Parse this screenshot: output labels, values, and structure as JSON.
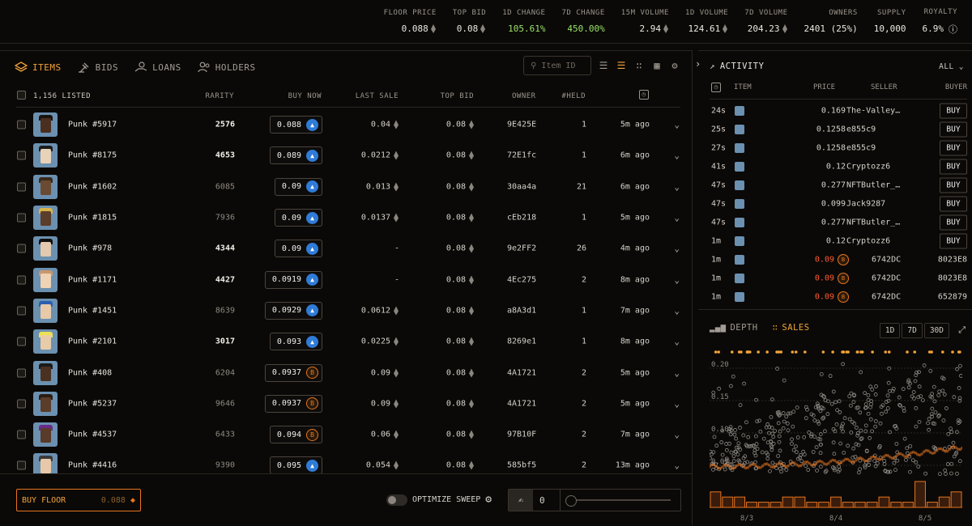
{
  "stats": [
    {
      "label": "FLOOR PRICE",
      "value": "0.088",
      "eth": true,
      "green": false
    },
    {
      "label": "TOP BID",
      "value": "0.08",
      "eth": true,
      "green": false
    },
    {
      "label": "1D CHANGE",
      "value": "105.61%",
      "eth": false,
      "green": true
    },
    {
      "label": "7D CHANGE",
      "value": "450.00%",
      "eth": false,
      "green": true
    },
    {
      "label": "15M VOLUME",
      "value": "2.94",
      "eth": true,
      "green": false
    },
    {
      "label": "1D VOLUME",
      "value": "124.61",
      "eth": true,
      "green": false
    },
    {
      "label": "7D VOLUME",
      "value": "204.23",
      "eth": true,
      "green": false
    },
    {
      "label": "OWNERS",
      "value": "2401 (25%)",
      "eth": false,
      "green": false
    },
    {
      "label": "SUPPLY",
      "value": "10,000",
      "eth": false,
      "green": false
    },
    {
      "label": "ROYALTY",
      "value": "6.9%",
      "eth": false,
      "green": false
    }
  ],
  "tabs": {
    "items": "ITEMS",
    "bids": "BIDS",
    "loans": "LOANS",
    "holders": "HOLDERS"
  },
  "search": {
    "placeholder": "Item ID"
  },
  "table": {
    "listed": "1,156 LISTED",
    "headers": {
      "rarity": "RARITY",
      "buy_now": "BUY NOW",
      "last_sale": "LAST SALE",
      "top_bid": "TOP BID",
      "owner": "OWNER",
      "held": "#HELD"
    },
    "rows": [
      {
        "name": "Punk #5917",
        "rarity": "2576",
        "rw": "b",
        "buy": "0.088",
        "mk": "b",
        "last": "0.04",
        "bid": "0.08",
        "owner": "9E425E",
        "held": "1",
        "age": "5m ago",
        "skin": "#4a2e1f",
        "hair": "#1a1410"
      },
      {
        "name": "Punk #8175",
        "rarity": "4653",
        "rw": "b",
        "buy": "0.089",
        "mk": "b",
        "last": "0.0212",
        "bid": "0.08",
        "owner": "72E1fc",
        "held": "1",
        "age": "6m ago",
        "skin": "#e8d2b8",
        "hair": "#1b1b1b"
      },
      {
        "name": "Punk #1602",
        "rarity": "6085",
        "rw": "d",
        "buy": "0.09",
        "mk": "b",
        "last": "0.013",
        "bid": "0.08",
        "owner": "30aa4a",
        "held": "21",
        "age": "6m ago",
        "skin": "#6a4a32",
        "hair": "#3a2a1d"
      },
      {
        "name": "Punk #1815",
        "rarity": "7936",
        "rw": "d",
        "buy": "0.09",
        "mk": "b",
        "last": "0.0137",
        "bid": "0.08",
        "owner": "cEb218",
        "held": "1",
        "age": "5m ago",
        "skin": "#5a3e2a",
        "hair": "#d8b24a"
      },
      {
        "name": "Punk #978",
        "rarity": "4344",
        "rw": "b",
        "buy": "0.09",
        "mk": "b",
        "last": "-",
        "bid": "0.08",
        "owner": "9e2FF2",
        "held": "26",
        "age": "4m ago",
        "skin": "#e3c9ad",
        "hair": "#101010"
      },
      {
        "name": "Punk #1171",
        "rarity": "4427",
        "rw": "b",
        "buy": "0.0919",
        "mk": "b",
        "last": "-",
        "bid": "0.08",
        "owner": "4Ec275",
        "held": "2",
        "age": "8m ago",
        "skin": "#f0d2b4",
        "hair": "#c89870"
      },
      {
        "name": "Punk #1451",
        "rarity": "8639",
        "rw": "d",
        "buy": "0.0929",
        "mk": "b",
        "last": "0.0612",
        "bid": "0.08",
        "owner": "a8A3d1",
        "held": "1",
        "age": "7m ago",
        "skin": "#e8c9a8",
        "hair": "#2a5fb0"
      },
      {
        "name": "Punk #2101",
        "rarity": "3017",
        "rw": "b",
        "buy": "0.093",
        "mk": "b",
        "last": "0.0225",
        "bid": "0.08",
        "owner": "8269e1",
        "held": "1",
        "age": "8m ago",
        "skin": "#e8ccaa",
        "hair": "#f0e050"
      },
      {
        "name": "Punk #408",
        "rarity": "6204",
        "rw": "d",
        "buy": "0.0937",
        "mk": "o",
        "last": "0.09",
        "bid": "0.08",
        "owner": "4A1721",
        "held": "2",
        "age": "5m ago",
        "skin": "#4a3020",
        "hair": "#1a1a1a"
      },
      {
        "name": "Punk #5237",
        "rarity": "9646",
        "rw": "d",
        "buy": "0.0937",
        "mk": "o",
        "last": "0.09",
        "bid": "0.08",
        "owner": "4A1721",
        "held": "2",
        "age": "5m ago",
        "skin": "#5a3c28",
        "hair": "#2a1c12"
      },
      {
        "name": "Punk #4537",
        "rarity": "6433",
        "rw": "d",
        "buy": "0.094",
        "mk": "o",
        "last": "0.06",
        "bid": "0.08",
        "owner": "97B10F",
        "held": "2",
        "age": "7m ago",
        "skin": "#5a3a28",
        "hair": "#6a2a8a"
      },
      {
        "name": "Punk #4416",
        "rarity": "9390",
        "rw": "d",
        "buy": "0.095",
        "mk": "b",
        "last": "0.054",
        "bid": "0.08",
        "owner": "585bf5",
        "held": "2",
        "age": "13m ago",
        "skin": "#e8c8a8",
        "hair": "#3a3a3a"
      }
    ]
  },
  "footer": {
    "buy_floor": "BUY FLOOR",
    "buy_floor_price": "0.088",
    "optimize": "OPTIMIZE SWEEP",
    "sweep_count": "0"
  },
  "activity": {
    "title": "ACTIVITY",
    "filter": "ALL",
    "headers": {
      "item": "ITEM",
      "price": "PRICE",
      "seller": "SELLER",
      "buyer": "BUYER"
    },
    "buy_label": "BUY",
    "rows": [
      {
        "time": "24s",
        "price": "0.169",
        "seller": "The-Valley…",
        "buyer": "",
        "red": false,
        "mk": false
      },
      {
        "time": "25s",
        "price": "0.1258",
        "seller": "e855c9",
        "buyer": "",
        "red": false,
        "mk": false
      },
      {
        "time": "27s",
        "price": "0.1258",
        "seller": "e855c9",
        "buyer": "",
        "red": false,
        "mk": false
      },
      {
        "time": "41s",
        "price": "0.12",
        "seller": "Cryptozz6",
        "buyer": "",
        "red": false,
        "mk": false
      },
      {
        "time": "47s",
        "price": "0.277",
        "seller": "NFTButler_…",
        "buyer": "",
        "red": false,
        "mk": false
      },
      {
        "time": "47s",
        "price": "0.099",
        "seller": "Jack9287",
        "buyer": "",
        "red": false,
        "mk": false
      },
      {
        "time": "47s",
        "price": "0.277",
        "seller": "NFTButler_…",
        "buyer": "",
        "red": false,
        "mk": false
      },
      {
        "time": "1m",
        "price": "0.12",
        "seller": "Cryptozz6",
        "buyer": "",
        "red": false,
        "mk": false
      },
      {
        "time": "1m",
        "price": "0.09",
        "seller": "6742DC",
        "buyer": "8023E8",
        "red": true,
        "mk": true
      },
      {
        "time": "1m",
        "price": "0.09",
        "seller": "6742DC",
        "buyer": "8023E8",
        "red": true,
        "mk": true
      },
      {
        "time": "1m",
        "price": "0.09",
        "seller": "6742DC",
        "buyer": "652879",
        "red": true,
        "mk": true
      }
    ]
  },
  "sales_chart": {
    "tabs": {
      "depth": "DEPTH",
      "sales": "SALES"
    },
    "timeframes": [
      "1D",
      "7D",
      "30D"
    ],
    "chart_data": {
      "type": "scatter",
      "yticks": [
        "0.20",
        "0.15",
        "0.10",
        "0.05"
      ],
      "ylim": [
        0.02,
        0.22
      ],
      "xticks": [
        "8/3",
        "8/4",
        "8/5"
      ],
      "volume_bars": [
        3,
        2,
        2,
        1,
        1,
        1,
        2,
        2,
        1,
        1,
        2,
        1,
        1,
        1,
        2,
        1,
        1,
        5,
        1,
        2,
        3
      ]
    }
  }
}
